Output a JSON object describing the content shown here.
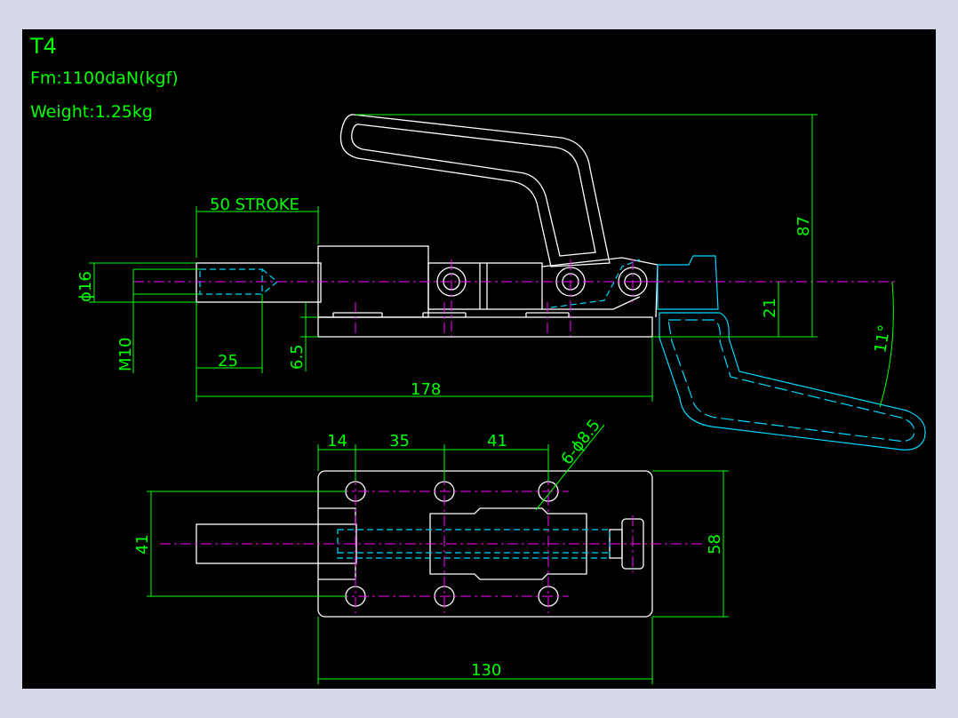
{
  "colors": {
    "background": "#000000",
    "frame": "#d5d8e8",
    "outline": "#ffffff",
    "dimension": "#00ff00",
    "centerline": "#ff00ff",
    "hidden": "#00d8ff"
  },
  "info": {
    "model": "T4",
    "force": "Fm:1100daN(kgf)",
    "weight": "Weight:1.25kg"
  },
  "side_view": {
    "stroke": "50 STROKE",
    "plunger_diameter": "ϕ16",
    "thread": "M10",
    "thread_length": "25",
    "base_thickness": "6.5",
    "overall_length": "178",
    "handle_height": "87",
    "pivot_height": "21",
    "handle_angle": "11°"
  },
  "top_view": {
    "dim_14": "14",
    "dim_35": "35",
    "dim_41_top": "41",
    "holes": "6-ϕ8.5",
    "hole_spacing_width": "41",
    "base_width": "58",
    "base_length": "130"
  }
}
